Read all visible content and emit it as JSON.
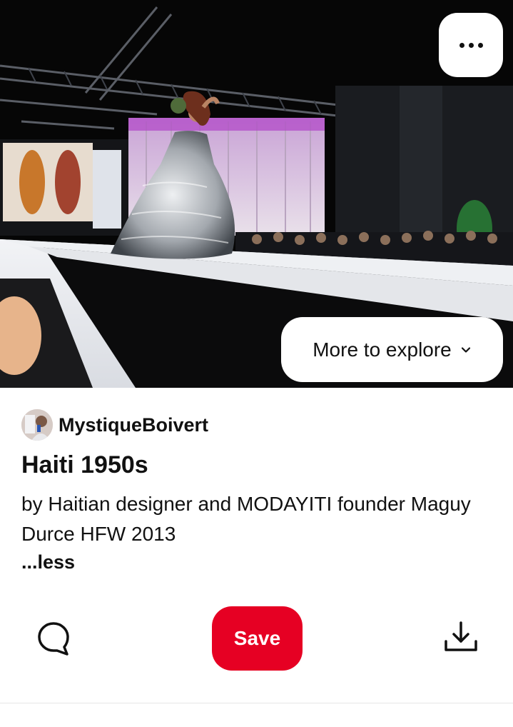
{
  "pin": {
    "image_alt": "Model in a silver ruffled ball gown on a fashion show runway",
    "more_icon": "ellipsis-icon",
    "explore_label": "More to explore",
    "explore_icon": "chevron-down-icon"
  },
  "creator": {
    "name": "MystiqueBoivert"
  },
  "details": {
    "title": "Haiti 1950s",
    "description": "by Haitian designer and MODAYITI founder Maguy Durce HFW 2013",
    "less_label": "...less"
  },
  "actions": {
    "comment_icon": "comment-icon",
    "save_label": "Save",
    "download_icon": "download-icon"
  },
  "colors": {
    "save_button": "#e60023",
    "text": "#111111",
    "background": "#ffffff"
  }
}
